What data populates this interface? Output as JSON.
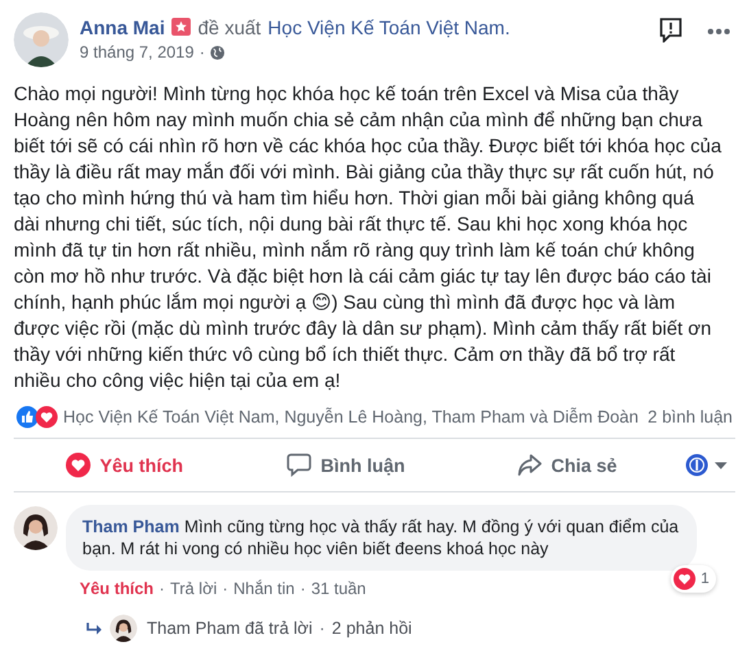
{
  "post": {
    "author": "Anna Mai",
    "action": "đề xuất",
    "page": "Học Viện Kế Toán Việt Nam.",
    "date": "9 tháng 7, 2019",
    "separator": "·",
    "text": "Chào mọi người! Mình từng học khóa học kế toán trên Excel và Misa của thầy Hoàng nên hôm nay mình muốn chia sẻ cảm nhận của mình để những bạn chưa biết tới sẽ có cái nhìn rõ hơn về các khóa học của thầy. Được biết tới khóa học của thầy là điều rất may mắn đối với mình. Bài giảng của thầy thực sự rất cuốn hút, nó tạo cho mình hứng thú và ham tìm hiểu hơn. Thời gian mỗi bài giảng không quá dài nhưng chi tiết, súc tích, nội dung bài rất thực tế. Sau khi học xong khóa học mình đã tự tin hơn rất nhiều, mình nắm rõ ràng quy trình làm kế toán chứ không còn mơ hồ như trước. Và đặc biệt hơn là cái cảm giác tự tay lên được báo cáo tài chính, hạnh phúc lắm mọi người ạ 😊) Sau cùng thì mình đã được học và làm được việc rồi (mặc dù mình trước đây là dân sư phạm). Mình cảm thấy rất biết ơn thầy với những kiến thức vô cùng bổ ích thiết thực. Cảm ơn thầy đã bổ trợ rất nhiều cho công việc hiện tại của em ạ!"
  },
  "reactions": {
    "names": "Học Viện Kế Toán Việt Nam, Nguyễn Lê Hoàng, Tham Pham và Diễm Đoàn",
    "comment_count": "2 bình luận"
  },
  "actions": [
    {
      "kind": "love",
      "label": "Yêu thích",
      "selected": true
    },
    {
      "kind": "comment",
      "label": "Bình luận",
      "selected": false
    },
    {
      "kind": "share",
      "label": "Chia sẻ",
      "selected": false
    }
  ],
  "comment": {
    "author": "Tham Pham",
    "text": "Mình cũng từng học và thấy rất hay. M đồng ý với quan điểm của bạn. M rát hi vong có nhiều học viên biết đeens khoá học này",
    "reaction_count": "1",
    "separator": "·",
    "links": [
      {
        "label": "Yêu thích",
        "selected": true
      },
      {
        "label": "Trả lời",
        "selected": false
      },
      {
        "label": "Nhắn tin",
        "selected": false
      },
      {
        "label": "31 tuần",
        "selected": false
      }
    ],
    "reply_summary": "Tham Pham đã trả lời",
    "reply_count": "2 phản hồi"
  }
}
